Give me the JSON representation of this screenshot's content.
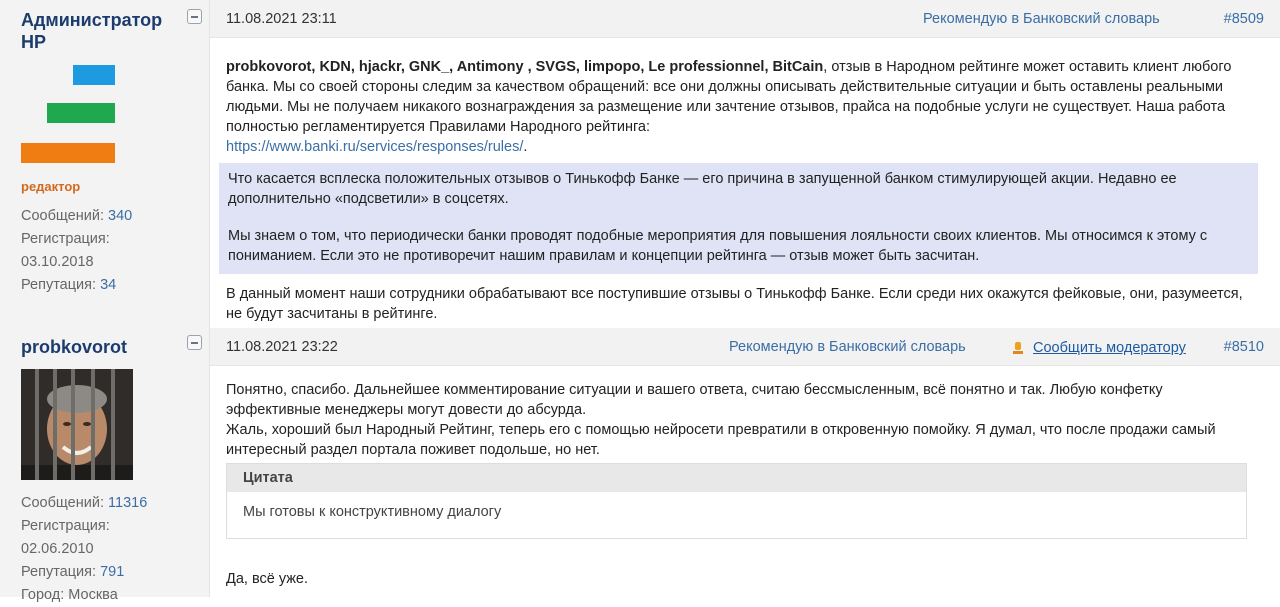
{
  "posts": [
    {
      "author": "Администратор НР",
      "role": "редактор",
      "stats": {
        "messages_label": "Сообщений:",
        "messages": "340",
        "reg_label": "Регистрация:",
        "reg_date": "03.10.2018",
        "rep_label": "Репутация:",
        "rep": "34"
      },
      "date": "11.08.2021 23:11",
      "recommend": "Рекомендую в Банковский словарь",
      "number": "#8509",
      "users": "probkovorot, KDN, hjackr, GNK_, Antimony , SVGS, limpopo, Le professionnel, BitCain",
      "p1": ", отзыв в Народном рейтинге может оставить клиент любого банка. Мы со своей стороны следим за качеством обращений: все они должны описывать действительные ситуации и быть оставлены реальными людьми. Мы не получаем никакого вознаграждения за размещение или зачтение отзывов, прайса на подобные услуги не существует. Наша работа полностью регламентируется Правилами Народного рейтинга:",
      "link": "https://www.banki.ru/services/responses/rules/",
      "link_tail": ".",
      "hl1": "Что касается всплеска положительных отзывов о Тинькофф Банке — его причина в запущенной банком стимулирующей акции. Недавно ее дополнительно «подсветили» в соцсетях.",
      "hl2": "Мы знаем о том, что периодически банки проводят подобные мероприятия для повышения лояльности своих клиентов. Мы относимся к этому с пониманием. Если это не противоречит нашим правилам и концепции рейтинга — отзыв может быть засчитан.",
      "p_end": "В данный момент наши сотрудники обрабатывают все поступившие отзывы о Тинькофф Банке. Если среди них окажутся фейковые, они, разумеется, не будут засчитаны в рейтинге.",
      "logo_colors": [
        "#1e9be0",
        "#1fa84f",
        "#f07d12"
      ]
    },
    {
      "author": "probkovorot",
      "stats": {
        "messages_label": "Сообщений:",
        "messages": "11316",
        "reg_label": "Регистрация:",
        "reg_date": "02.06.2010",
        "rep_label": "Репутация:",
        "rep": "791",
        "city_label": "Город:",
        "city": "Москва"
      },
      "date": "11.08.2021 23:22",
      "recommend": "Рекомендую в Банковский словарь",
      "report": "Сообщить модератору",
      "number": "#8510",
      "p1": "Понятно, спасибо. Дальнейшее комментирование ситуации и вашего ответа, считаю бессмысленным, всё понятно и так. Любую конфетку эффективные менеджеры могут довести до абсурда.",
      "p2": "Жаль, хороший был Народный Рейтинг, теперь его с помощью нейросети превратили в откровенную помойку. Я думал, что после продажи самый интересный раздел портала поживет подольше, но нет.",
      "quote_title": "Цитата",
      "quote_text": "Мы готовы к конструктивному диалогу",
      "p_end": "Да, всё уже."
    }
  ]
}
